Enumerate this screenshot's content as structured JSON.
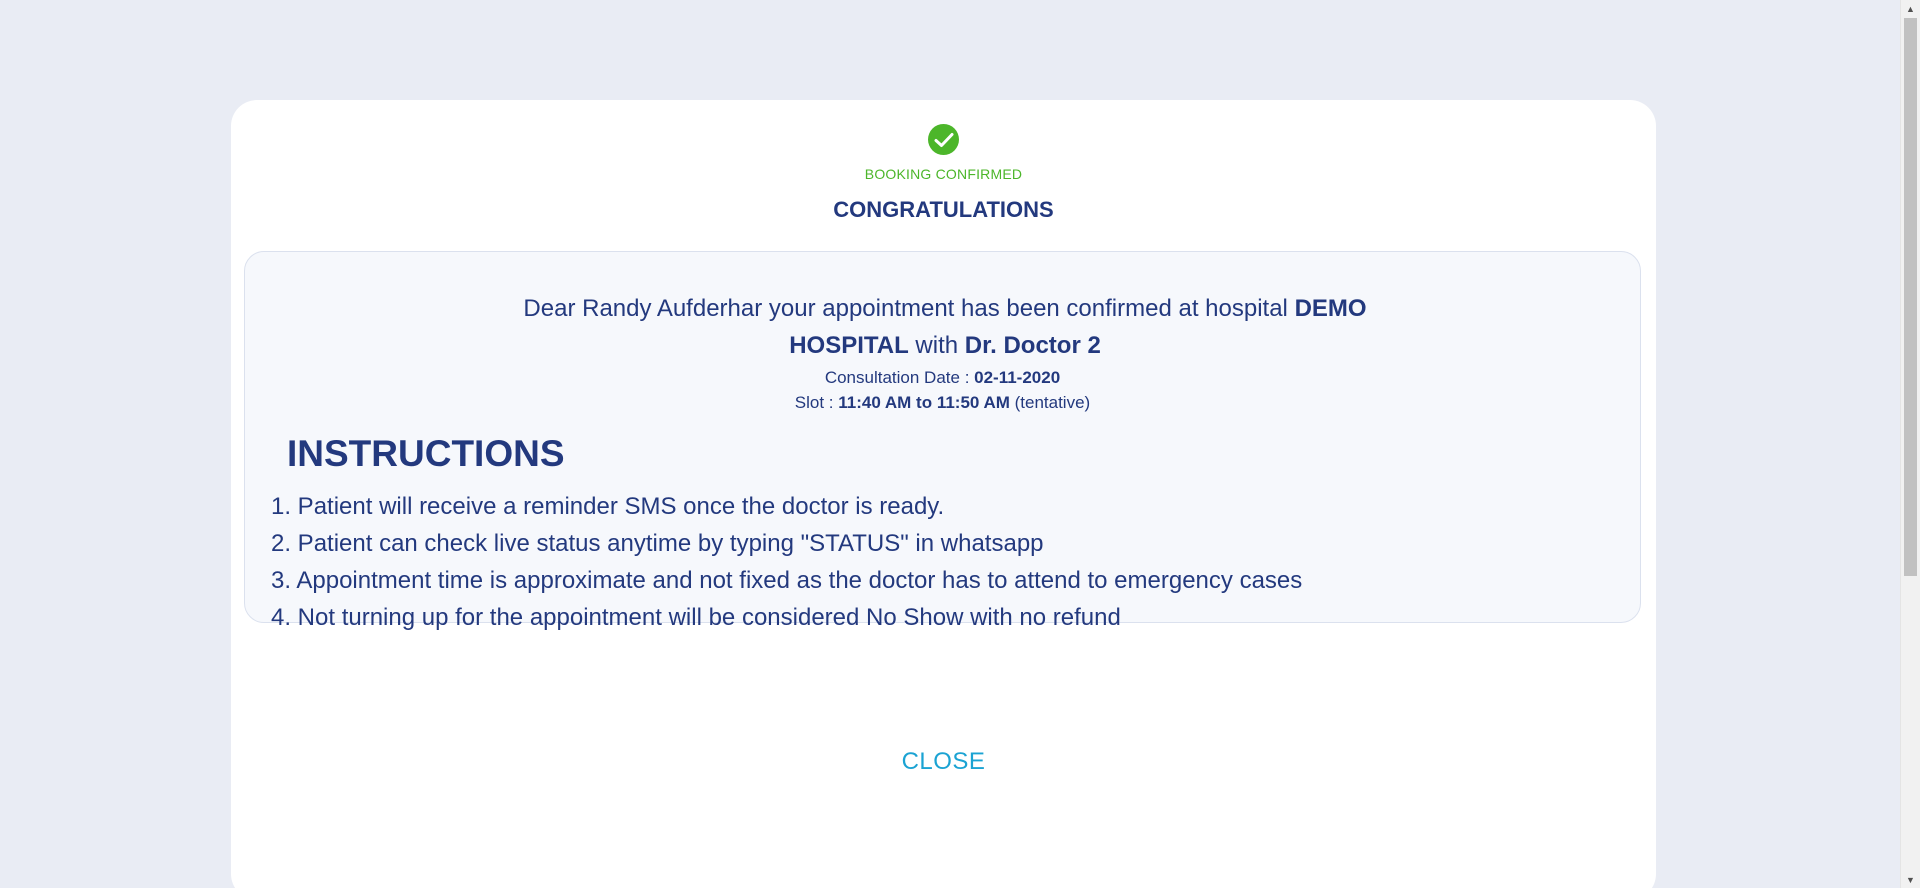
{
  "status": {
    "icon": "check-circle-icon",
    "label": "BOOKING CONFIRMED"
  },
  "heading": "CONGRATULATIONS",
  "message": {
    "prefix": "Dear Randy Aufderhar your appointment has been confirmed at hospital ",
    "hospital": "DEMO HOSPITAL",
    "with_text": " with ",
    "doctor": "Dr. Doctor 2"
  },
  "consultation": {
    "label": "Consultation Date : ",
    "date": "02-11-2020"
  },
  "slot": {
    "label": "Slot : ",
    "time": "11:40 AM to 11:50 AM",
    "note": " (tentative)"
  },
  "instructions": {
    "title": "INSTRUCTIONS",
    "items": [
      "1. Patient will receive a reminder SMS once the doctor is ready.",
      "2. Patient can check live status anytime by typing \"STATUS\" in whatsapp",
      "3. Appointment time is approximate and not fixed as the doctor has to attend to emergency cases",
      "4. Not turning up for the appointment will be considered No Show with no refund"
    ]
  },
  "close_label": "CLOSE",
  "colors": {
    "page_bg": "#e9ecf4",
    "primary_text": "#23397e",
    "success": "#4cb62a",
    "link": "#1ba3d3"
  }
}
